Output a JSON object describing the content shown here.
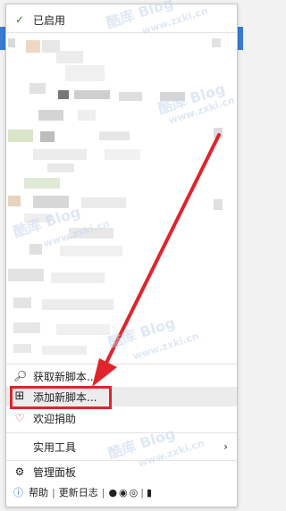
{
  "menu": {
    "enabled_label": "已启用",
    "find_scripts": "获取新脚本...",
    "add_script": "添加新脚本...",
    "donate": "欢迎捐助",
    "utilities": "实用工具",
    "dashboard": "管理面板",
    "help": "帮助",
    "changelog": "更新日志",
    "separator": "|"
  },
  "icons": {
    "enabled": "checkmark-icon",
    "find": "search-icon",
    "add": "plus-square-icon",
    "donate": "heart-icon",
    "utilities_arrow": "chevron-right-icon",
    "dashboard": "gear-icon",
    "help": "info-icon",
    "github": "github-icon",
    "social1": "circle-icon",
    "instagram": "instagram-icon",
    "mobile": "phone-icon"
  },
  "colors": {
    "check": "#2e7d32",
    "heart": "#d3304a",
    "arrow": "#e0242b",
    "highlight_box": "#e0242b",
    "info": "#2a6fd6"
  },
  "watermark": {
    "text1": "酷库 Blog",
    "text2": "www.zxki.cn"
  }
}
